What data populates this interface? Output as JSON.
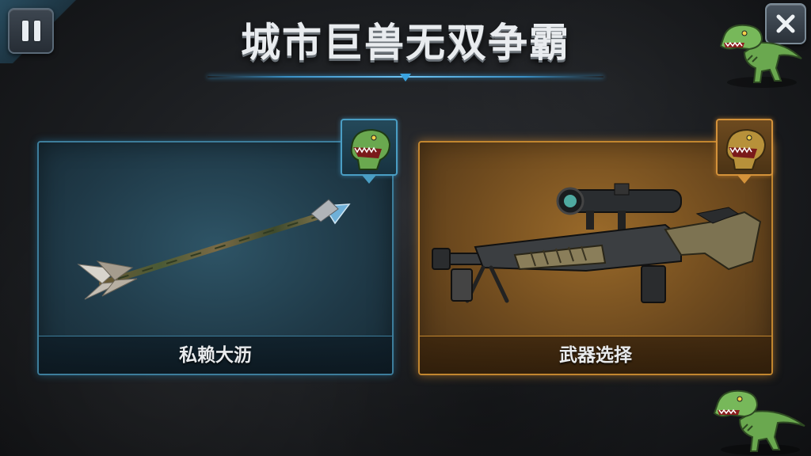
{
  "header": {
    "title": "城市巨兽无双争霸"
  },
  "controls": {
    "pause_icon": "pause-icon",
    "close_icon": "close-icon"
  },
  "cards": [
    {
      "label": "私赖大沥",
      "weapon": "arrow",
      "theme": "blue",
      "accent": "#3d7d9b"
    },
    {
      "label": "武器选择",
      "weapon": "sniper-rifle",
      "theme": "orange",
      "accent": "#c2862f"
    }
  ],
  "colors": {
    "blue_accent": "#4a9ec4",
    "orange_accent": "#d4923a",
    "dino_green": "#6aa84f"
  }
}
